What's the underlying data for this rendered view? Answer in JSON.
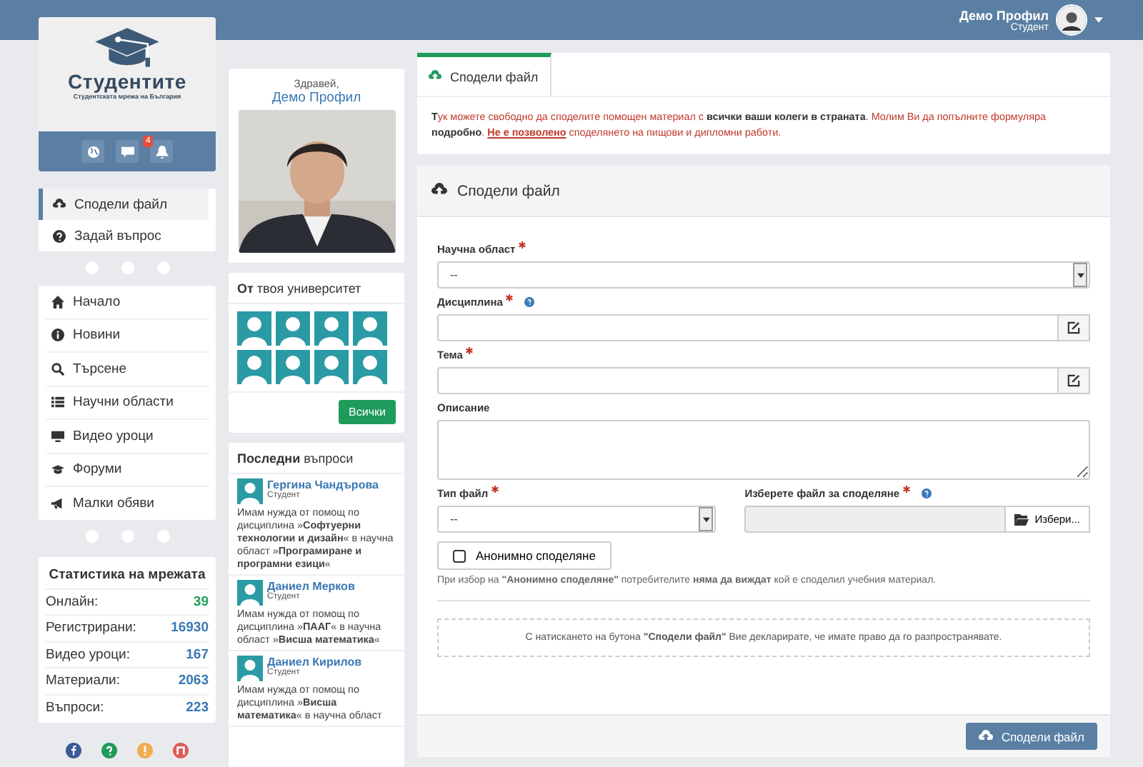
{
  "header": {
    "user_name": "Демо Профил",
    "user_role": "Студент"
  },
  "logo": {
    "title": "Студентите",
    "subtitle": "Студентската мрежа на България",
    "badge": "4"
  },
  "action_menu": [
    {
      "label": "Сподели файл",
      "selected": true
    },
    {
      "label": "Задай въпрос",
      "selected": false
    }
  ],
  "nav_menu": [
    {
      "label": "Начало"
    },
    {
      "label": "Новини"
    },
    {
      "label": "Търсене"
    },
    {
      "label": "Научни области"
    },
    {
      "label": "Видео уроци"
    },
    {
      "label": "Форуми"
    },
    {
      "label": "Малки обяви"
    }
  ],
  "stats": {
    "title": "Статистика на мрежата",
    "rows": [
      {
        "label": "Онлайн:",
        "value": "39",
        "color": "#27a060"
      },
      {
        "label": "Регистрирани:",
        "value": "16930",
        "color": "#3a78b5"
      },
      {
        "label": "Видео уроци:",
        "value": "167",
        "color": "#3a78b5"
      },
      {
        "label": "Материали:",
        "value": "2063",
        "color": "#3a78b5"
      },
      {
        "label": "Въпроси:",
        "value": "223",
        "color": "#3a78b5"
      }
    ]
  },
  "footer_icons": [
    {
      "color": "#3b5998"
    },
    {
      "color": "#1f9b5c"
    },
    {
      "color": "#f0ad4e"
    },
    {
      "color": "#e05a5a"
    }
  ],
  "profile": {
    "greeting": "Здравей,",
    "name": "Демо Профил"
  },
  "university": {
    "title": "**От** твоя университет",
    "button": "Всички"
  },
  "questions": {
    "title": "**Последни** въпроси",
    "items": [
      {
        "name": "Гергина Чандърова",
        "role": "Студент",
        "text": "Имам нужда от помощ по дисциплина »**Софтуерни технологии и дизайн**« в научна област »**Програмиране и програмни езици**«"
      },
      {
        "name": "Даниел Мерков",
        "role": "Студент",
        "text": "Имам нужда от помощ по дисциплина »**ПААГ**« в научна област »**Висша математика**«"
      },
      {
        "name": "Даниел Кирилов",
        "role": "Студент",
        "text": "Имам нужда от помощ по дисциплина »**Висша математика**« в научна област"
      }
    ]
  },
  "tab": {
    "label": "Сподели файл",
    "selected": true
  },
  "notice": {
    "text": "**Т**ук можете свободно да споделите помощен материал с **всички ваши колеги в страната**. Молим Ви да попълните формуляра **подробно**.",
    "link": "Не е позволено",
    "tail": "споделянето на пищови и дипломни работи."
  },
  "panel": {
    "title": "Сподели файл"
  },
  "fields": [
    {
      "kind": "select",
      "label": "Научна област",
      "required": true,
      "help": false,
      "value": "--"
    },
    {
      "kind": "text",
      "label": "Дисциплина",
      "required": true,
      "help": true
    },
    {
      "kind": "text",
      "label": "Тема",
      "required": true,
      "help": false
    },
    {
      "kind": "textarea",
      "label": "Описание",
      "required": false,
      "help": false
    }
  ],
  "file_type": {
    "label": "Тип файл",
    "required": true,
    "value": "--"
  },
  "file_pick": {
    "label": "Изберете файл за споделяне",
    "required": true,
    "help": true,
    "button": "Избери..."
  },
  "anonymous": {
    "label": "Анонимно споделяне",
    "checked": false
  },
  "hint": "При избор на **\"Анонимно споделяне\"** потребителите **няма да виждат** кой е споделил учебния материал.",
  "declaration": "С натискането на бутона **\"Сподели файл\"** Вие декларирате, че имате право да го разпространявате.",
  "submit": "Сподели файл"
}
